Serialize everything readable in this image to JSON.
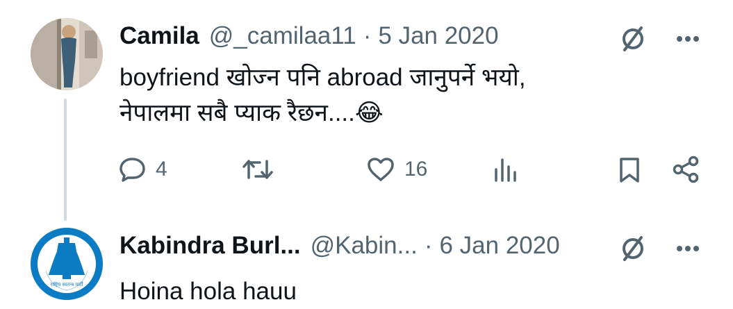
{
  "tweet": {
    "name": "Camila",
    "handle": "@_camilaa11",
    "separator": "·",
    "date": "5 Jan 2020",
    "text_line1": "boyfriend खोज्न पनि abroad जानुपर्ने भयो,",
    "text_line2": "नेपालमा सबै प्याक रैछन....",
    "emoji": "😂",
    "replies": "4",
    "likes": "16"
  },
  "reply": {
    "name": "Kabindra Burl...",
    "handle": "@Kabin...",
    "separator": "·",
    "date": "6 Jan 2020",
    "text": "Hoina hola hauu",
    "avatar_logo_text": "राष्ट्रिय स्वतन्त्र पार्टी"
  },
  "icons": {
    "grok": "grok-icon",
    "more": "more-icon",
    "reply": "reply-icon",
    "retweet": "retweet-icon",
    "like": "like-icon",
    "views": "views-icon",
    "bookmark": "bookmark-icon",
    "share": "share-icon"
  },
  "colors": {
    "text": "#0f1419",
    "secondary": "#536471",
    "thread_line": "#cfd9de",
    "logo_blue": "#0b7cc4"
  }
}
